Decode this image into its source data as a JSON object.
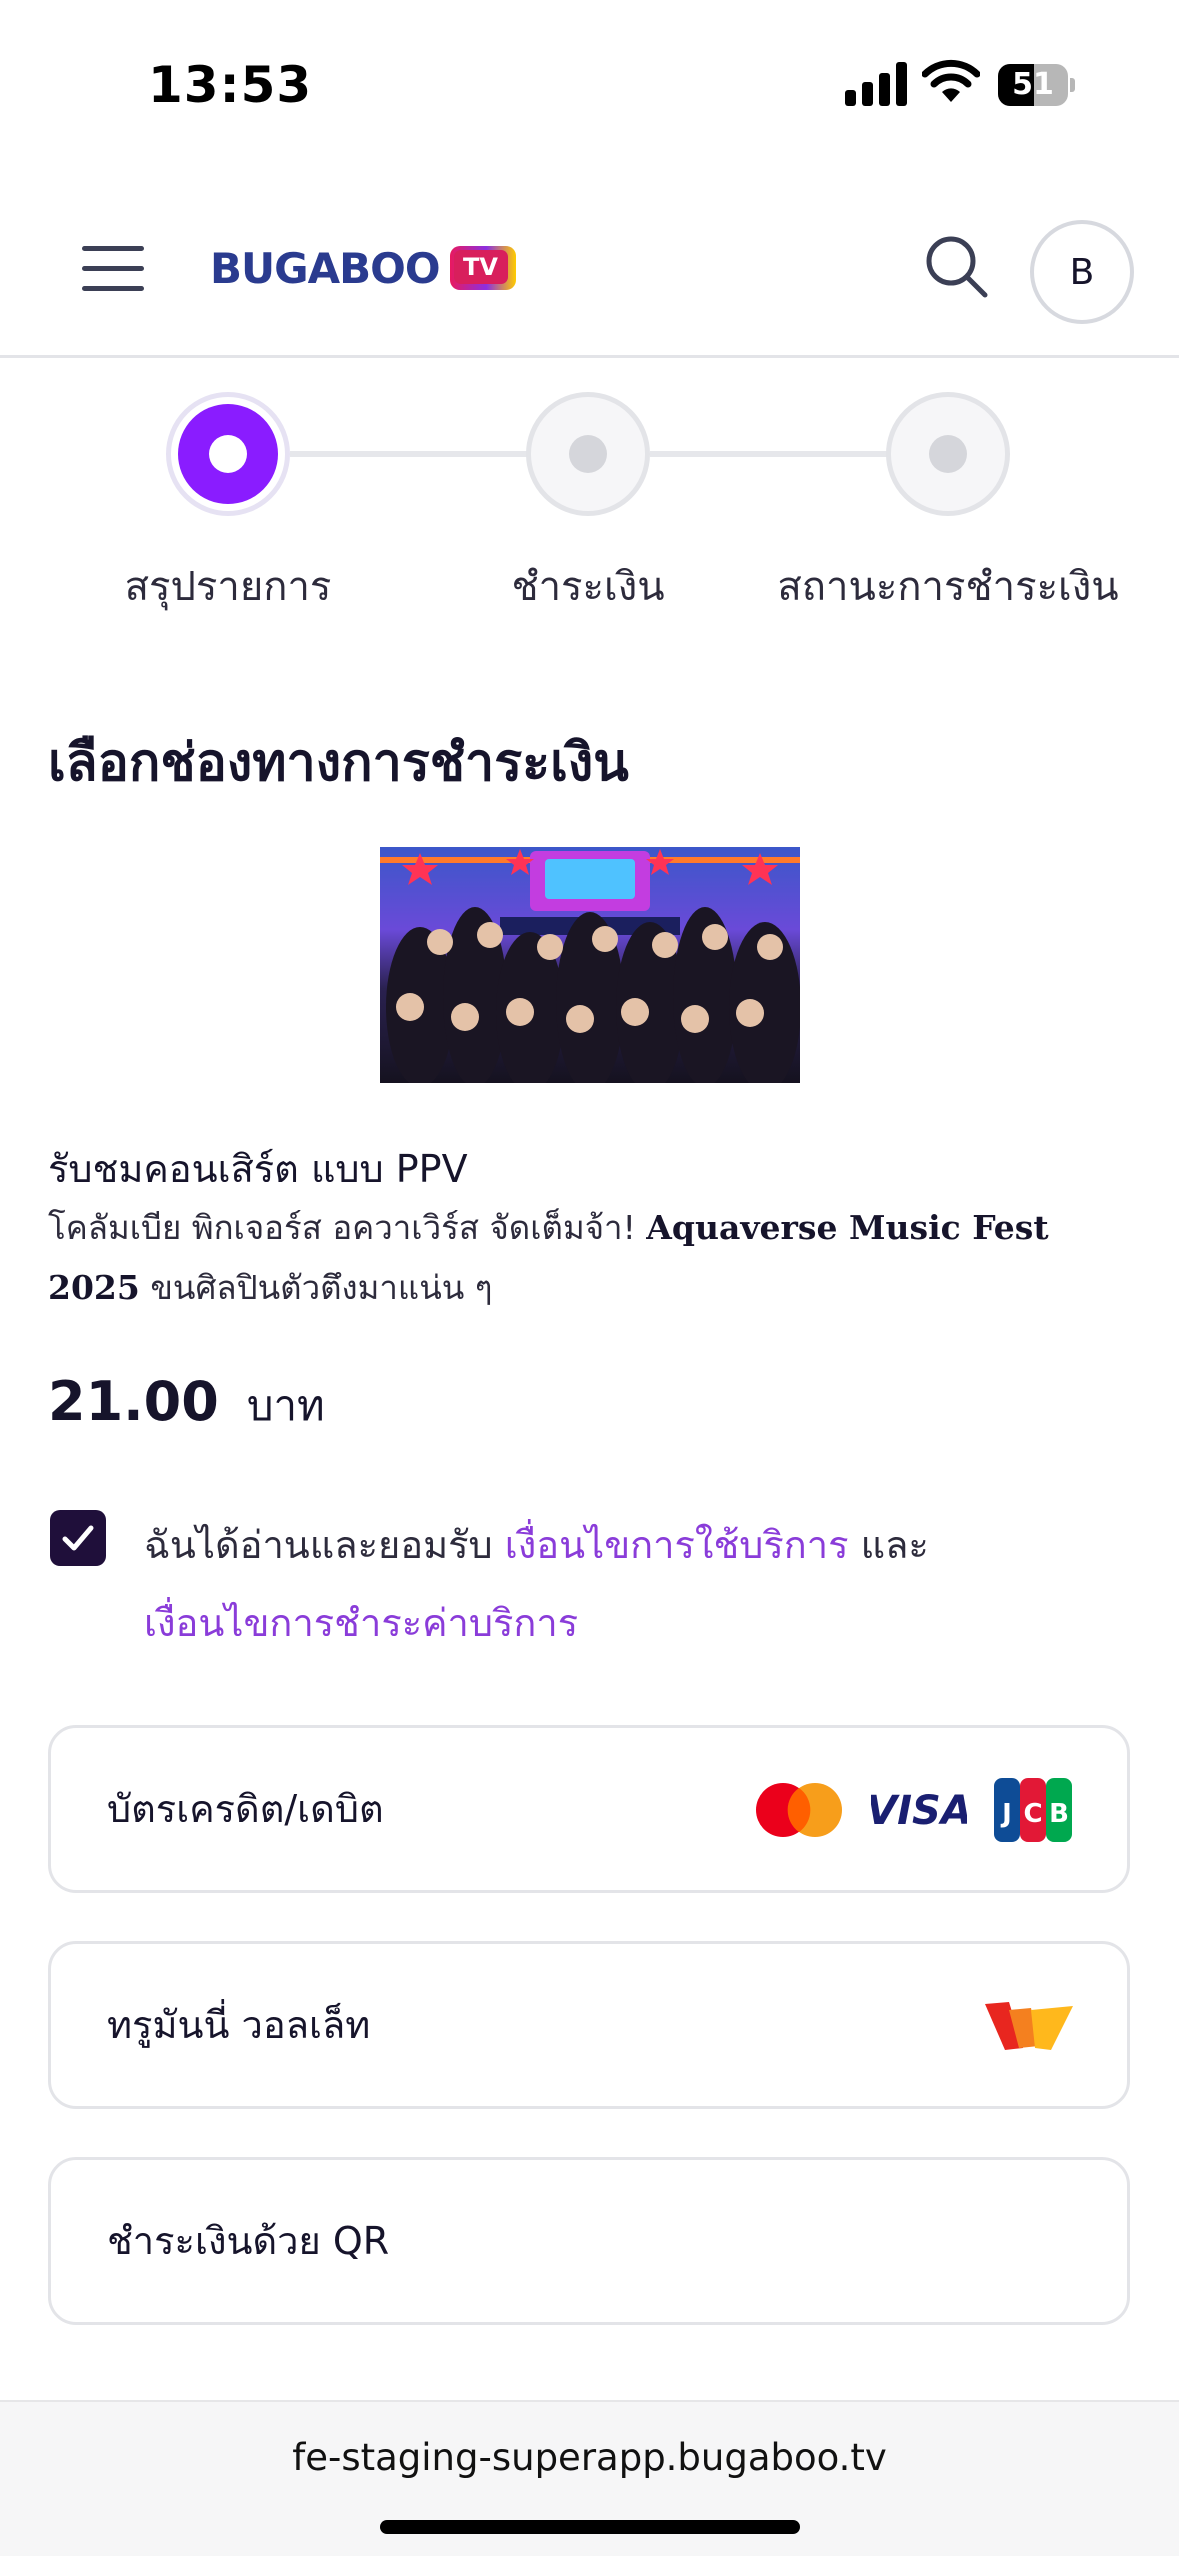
{
  "status_bar": {
    "time": "13:53",
    "battery": "51",
    "battery_level": 0.51
  },
  "header": {
    "logo_text": "BUGABOO",
    "logo_badge": "TV",
    "avatar_initial": "B"
  },
  "stepper": {
    "steps": [
      {
        "label": "สรุปรายการ",
        "state": "active"
      },
      {
        "label": "ชำระเงิน",
        "state": "inactive"
      },
      {
        "label": "สถานะการชำระเงิน",
        "state": "inactive"
      }
    ]
  },
  "main": {
    "section_title": "เลือกช่องทางการชำระเงิน",
    "product": {
      "title": "รับชมคอนเสิร์ต แบบ PPV",
      "desc_prefix": "โคลัมเบีย พิกเจอร์ส อควาเวิร์ส จัดเต็มจ้า! ",
      "desc_bold": "Aquaverse Music Fest 2025",
      "desc_suffix": " ขนศิลปินตัวตึงมาแน่น ๆ",
      "price": "21.00",
      "currency": "บาท"
    },
    "consent": {
      "checked": true,
      "text_before": "ฉันได้อ่านและยอมรับ ",
      "link_terms": "เงื่อนไขการใช้บริการ",
      "text_middle": " และ",
      "link_payment_terms": "เงื่อนไขการชำระค่าบริการ"
    },
    "payment_options": [
      {
        "label": "บัตรเครดิต/เดบิต",
        "logos": [
          "mastercard-icon",
          "visa-icon",
          "jcb-icon"
        ]
      },
      {
        "label": "ทรูมันนี่ วอลเล็ท",
        "logos": [
          "truemoney-icon"
        ]
      },
      {
        "label": "ชำระเงินด้วย QR",
        "logos": []
      }
    ]
  },
  "browser": {
    "url": "fe-staging-superapp.bugaboo.tv"
  },
  "colors": {
    "accent": "#8a1cff",
    "link": "#8a3cd9",
    "text": "#16142b",
    "border": "#e3e4e8"
  }
}
